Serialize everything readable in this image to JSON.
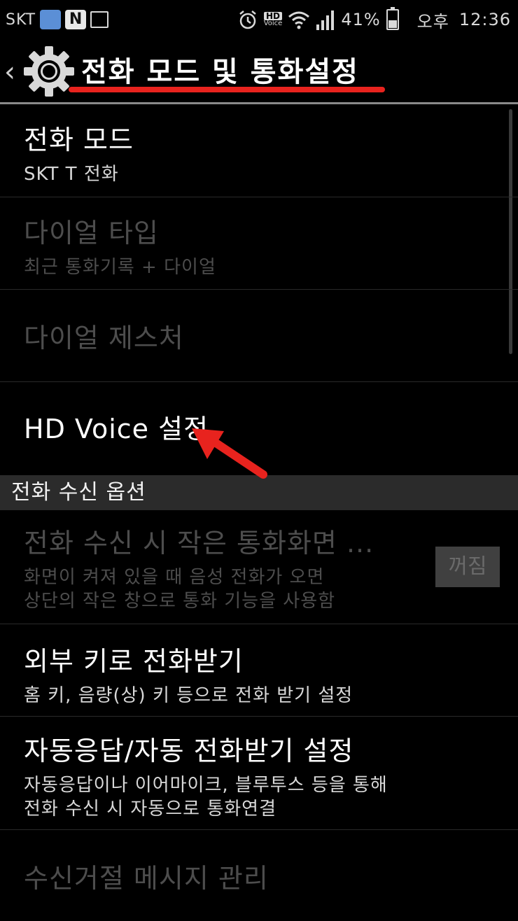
{
  "status_bar": {
    "carrier": "SKT",
    "hd_voice_top": "HD",
    "hd_voice_bottom": "Voice",
    "battery": "41%",
    "battery_level": 0.41,
    "time_period": "오후",
    "time": "12:36"
  },
  "header": {
    "title": "전화 모드 및 통화설정",
    "underline_color": "#e8231e"
  },
  "items": [
    {
      "title": "전화 모드",
      "subtitle": "SKT T 전화",
      "enabled": true
    },
    {
      "title": "다이얼 타입",
      "subtitle": "최근 통화기록 + 다이얼",
      "enabled": false
    },
    {
      "title": "다이얼 제스처",
      "subtitle": "",
      "enabled": false
    },
    {
      "title": "HD Voice 설정",
      "subtitle": "",
      "enabled": true
    }
  ],
  "section_header": "전화 수신 옵션",
  "call_items": [
    {
      "title": "전화 수신 시 작은 통화화면 ...",
      "subtitle_line1": "화면이 켜져 있을 때 음성 전화가 오면",
      "subtitle_line2": "상단의 작은 창으로 통화 기능을 사용함",
      "toggle": "꺼짐",
      "enabled": false
    },
    {
      "title": "외부 키로 전화받기",
      "subtitle": "홈 키, 음량(상) 키 등으로 전화 받기 설정",
      "enabled": true
    },
    {
      "title": "자동응답/자동 전화받기 설정",
      "subtitle_line1": "자동응답이나 이어마이크, 블루투스 등을 통해",
      "subtitle_line2": "전화 수신 시 자동으로 통화연결",
      "enabled": true
    },
    {
      "title": "수신거절 메시지 관리",
      "enabled": false
    }
  ],
  "annotation_color": "#e8231e"
}
